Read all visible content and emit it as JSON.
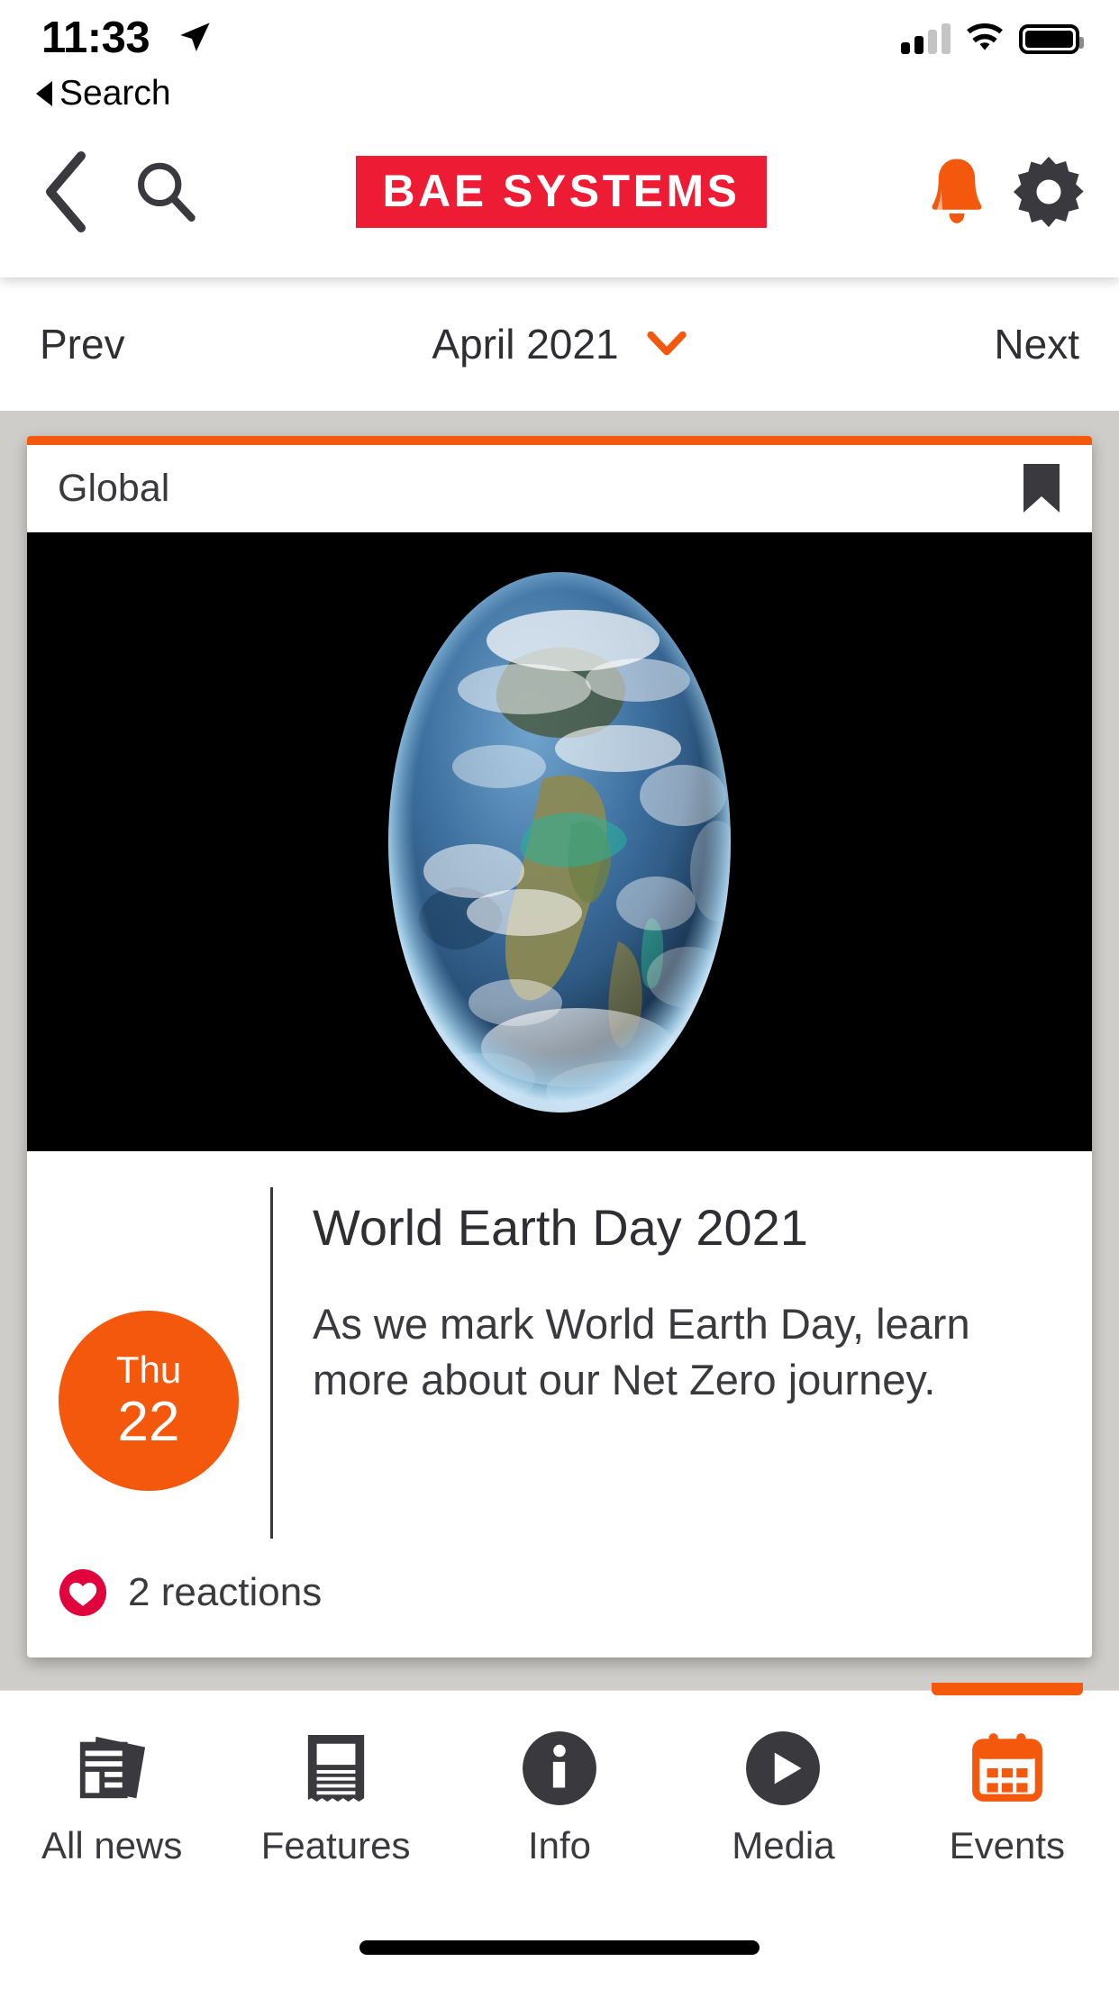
{
  "status_bar": {
    "time": "11:33",
    "location_icon": "location-arrow-icon",
    "signal_icon": "cellular-signal-icon",
    "wifi_icon": "wifi-icon",
    "battery_icon": "battery-full-icon",
    "back_to_app_label": "Search",
    "back_to_app_icon": "triangle-left-icon"
  },
  "header": {
    "back_icon": "chevron-left-icon",
    "search_icon": "search-icon",
    "logo_text": "BAE SYSTEMS",
    "logo_bg": "#ED1B34",
    "bell_icon": "bell-icon",
    "bell_color": "#F4580C",
    "gear_icon": "gear-icon",
    "gear_color": "#3a3a3e"
  },
  "month_nav": {
    "prev_label": "Prev",
    "month_label": "April 2021",
    "dropdown_icon": "chevron-down-icon",
    "dropdown_color": "#F4580C",
    "next_label": "Next"
  },
  "card": {
    "accent_color": "#F4580C",
    "region_label": "Global",
    "bookmark_icon": "bookmark-icon",
    "image_alt": "earth-from-space-photo",
    "date": {
      "day_of_week": "Thu",
      "day_number": "22"
    },
    "title": "World Earth Day 2021",
    "description": "As we mark World Earth Day, learn more about our Net Zero journey.",
    "reactions": {
      "icon": "heart-icon",
      "icon_color": "#E0033C",
      "label": "2 reactions"
    }
  },
  "tab_bar": {
    "active_color": "#F4580C",
    "inactive_color": "#3a3a3e",
    "tabs": [
      {
        "label": "All news",
        "icon": "newspapers-icon",
        "active": false
      },
      {
        "label": "Features",
        "icon": "document-icon",
        "active": false
      },
      {
        "label": "Info",
        "icon": "info-circle-icon",
        "active": false
      },
      {
        "label": "Media",
        "icon": "play-circle-icon",
        "active": false
      },
      {
        "label": "Events",
        "icon": "calendar-icon",
        "active": true
      }
    ]
  }
}
